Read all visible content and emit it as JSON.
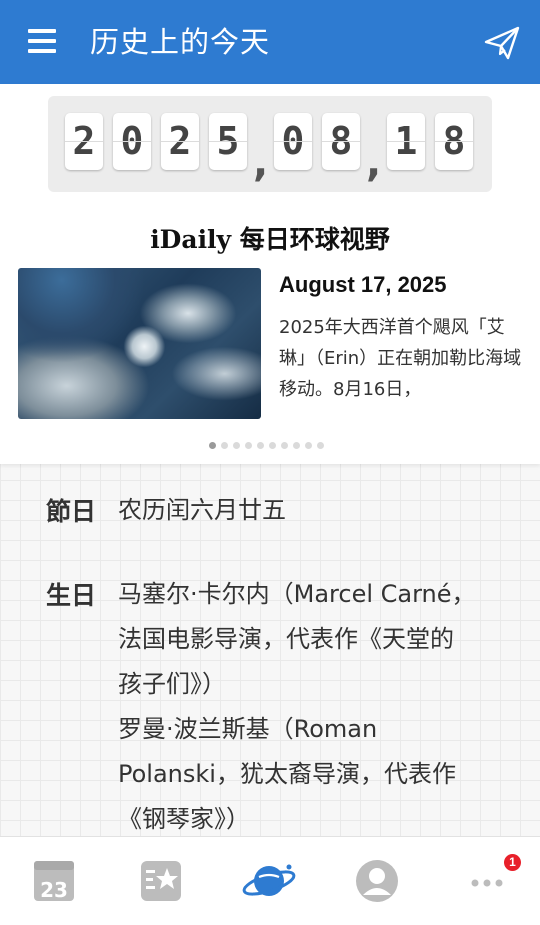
{
  "appbar": {
    "title": "历史上的今天"
  },
  "counter": {
    "digits": [
      "2",
      "0",
      "2",
      "5",
      "0",
      "8",
      "1",
      "8"
    ],
    "separator": ","
  },
  "featured": {
    "brand": "iDaily 每日环球视野",
    "date": "August 17, 2025",
    "summary": "2025年大西洋首个飓风「艾琳」（Erin）正在朝加勒比海域移动。8月16日，",
    "carousel_total": 10,
    "carousel_active": 1
  },
  "entries": [
    {
      "label": "節日",
      "lines": [
        "农历闰六月廿五"
      ]
    },
    {
      "label": "生日",
      "lines": [
        "马塞尔·卡尔内（Marcel Carné，",
        "法国电影导演，代表作《天堂的",
        "孩子们》）",
        "罗曼·波兰斯基（Roman",
        "Polanski，犹太裔导演，代表作",
        "《钢琴家》）"
      ]
    }
  ],
  "bottom_nav": {
    "calendar_day": "23",
    "more_badge": "1"
  },
  "colors": {
    "appbar": "#2e7bd1",
    "active_tab": "#2e7bd1",
    "inactive_tab": "#bcbcbc",
    "badge": "#e8202a"
  }
}
